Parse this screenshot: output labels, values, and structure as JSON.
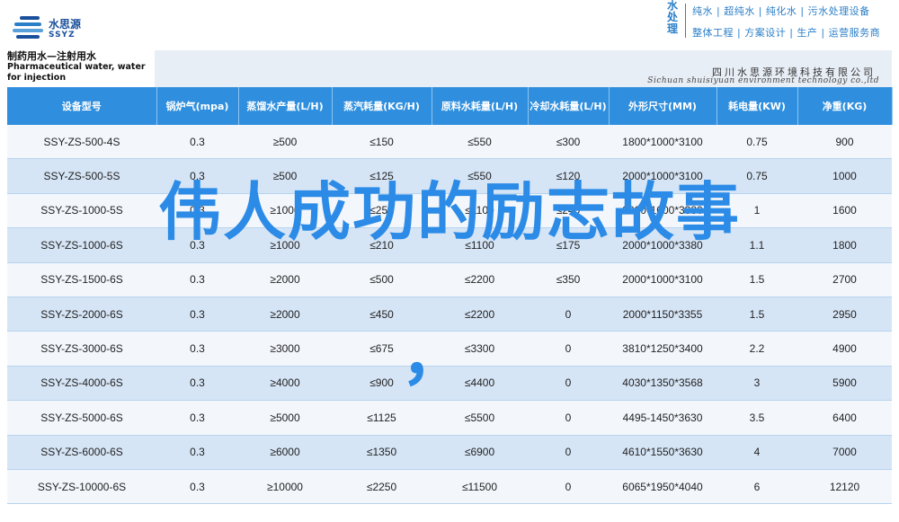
{
  "logo": {
    "name_cn": "水思源",
    "name_en": "SSYZ",
    "bar_colors": [
      "#1a4f9c",
      "#2b7fc8",
      "#5aa0da",
      "#1a4f9c"
    ]
  },
  "top_right": {
    "vertical_text": "水处理",
    "line1": "纯水 | 超纯水 | 纯化水 | 污水处理设备",
    "line2": "整体工程 | 方案设计 | 生产 | 运营服务商",
    "accent_color": "#2b7fc8"
  },
  "doc": {
    "title_cn": "制药用水—注射用水",
    "title_en": "Pharmaceutical water, water for injection",
    "company_cn": "四川水思源环境科技有限公司",
    "company_en": "Sichuan shuisiyuan environment technology co.,ltd"
  },
  "table": {
    "headers": [
      "设备型号",
      "锅炉气(mpa)",
      "蒸馏水产量(L/H)",
      "蒸汽耗量(KG/H)",
      "原料水耗量(L/H)",
      "冷却水耗量(L/H)",
      "外形尺寸(MM)",
      "耗电量(KW)",
      "净重(KG)"
    ],
    "rows": [
      [
        "SSY-ZS-500-4S",
        "0.3",
        "≥500",
        "≤150",
        "≤550",
        "≤300",
        "1800*1000*3100",
        "0.75",
        "900"
      ],
      [
        "SSY-ZS-500-5S",
        "0.3",
        "≥500",
        "≤125",
        "≤550",
        "≤120",
        "2000*1000*3100",
        "0.75",
        "1000"
      ],
      [
        "SSY-ZS-1000-5S",
        "0.3",
        "≥1000",
        "≤250",
        "≤1100",
        "≤240",
        "2000*1000*3380",
        "1",
        "1600"
      ],
      [
        "SSY-ZS-1000-6S",
        "0.3",
        "≥1000",
        "≤210",
        "≤1100",
        "≤175",
        "2000*1000*3380",
        "1.1",
        "1800"
      ],
      [
        "SSY-ZS-1500-6S",
        "0.3",
        "≥2000",
        "≤500",
        "≤2200",
        "≤350",
        "2000*1000*3100",
        "1.5",
        "2700"
      ],
      [
        "SSY-ZS-2000-6S",
        "0.3",
        "≥2000",
        "≤450",
        "≤2200",
        "0",
        "2000*1150*3355",
        "1.5",
        "2950"
      ],
      [
        "SSY-ZS-3000-6S",
        "0.3",
        "≥3000",
        "≤675",
        "≤3300",
        "0",
        "3810*1250*3400",
        "2.2",
        "4900"
      ],
      [
        "SSY-ZS-4000-6S",
        "0.3",
        "≥4000",
        "≤900",
        "≤4400",
        "0",
        "4030*1350*3568",
        "3",
        "5900"
      ],
      [
        "SSY-ZS-5000-6S",
        "0.3",
        "≥5000",
        "≤1125",
        "≤5500",
        "0",
        "4495-1450*3630",
        "3.5",
        "6400"
      ],
      [
        "SSY-ZS-6000-6S",
        "0.3",
        "≥6000",
        "≤1350",
        "≤6900",
        "0",
        "4610*1550*3630",
        "4",
        "7000"
      ],
      [
        "SSY-ZS-10000-6S",
        "0.3",
        "≥10000",
        "≤2250",
        "≤11500",
        "0",
        "6065*1950*4040",
        "6",
        "12120"
      ]
    ]
  },
  "overlay": {
    "title": "伟人成功的励志故事",
    "comma": "，",
    "color": "#2b8be6"
  }
}
